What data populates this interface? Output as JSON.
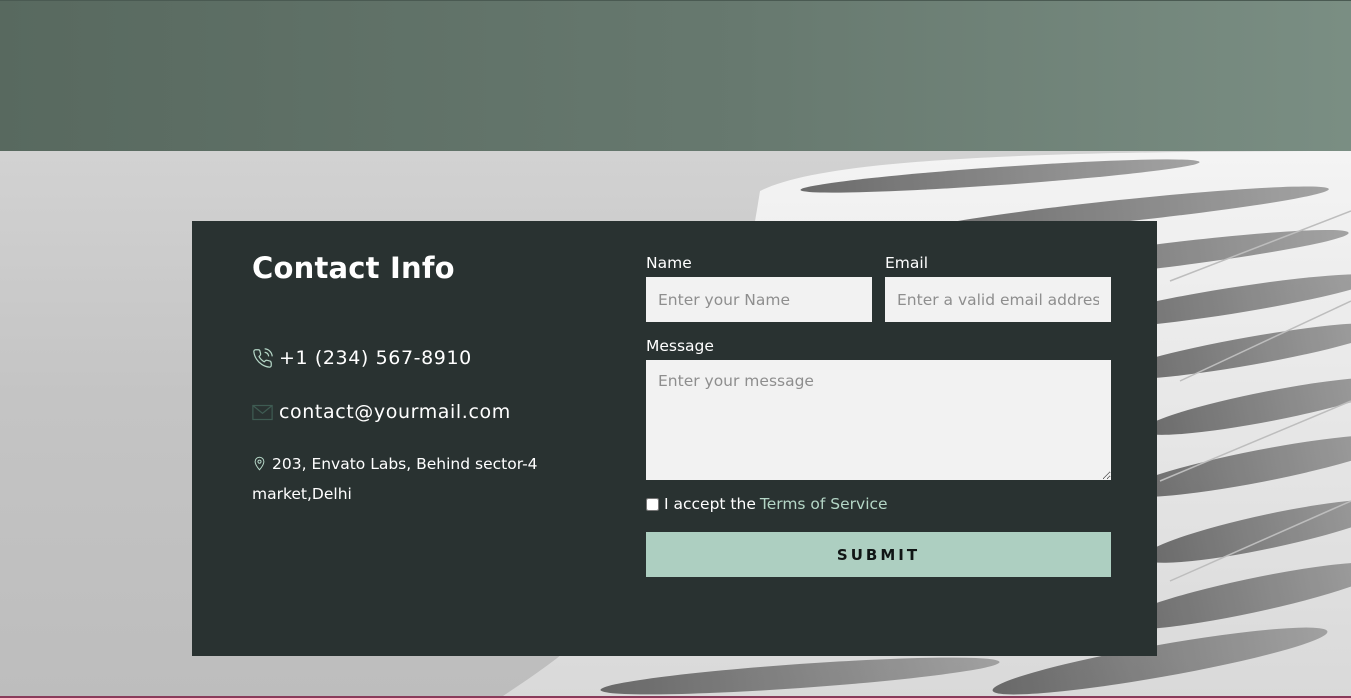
{
  "contact_info": {
    "title": "Contact Info",
    "phone": "+1 (234) 567-8910",
    "email": "contact@yourmail.com",
    "address": "203, Envato Labs, Behind sector-4 market,Delhi"
  },
  "form": {
    "name_label": "Name",
    "name_placeholder": "Enter your Name",
    "email_label": "Email",
    "email_placeholder": "Enter a valid email address",
    "message_label": "Message",
    "message_placeholder": "Enter your message",
    "terms_prefix": "I accept the",
    "terms_link": "Terms of Service",
    "submit_label": "SUBMIT",
    "terms_checked": false
  },
  "icons": {
    "phone": "phone-icon",
    "email": "envelope-icon",
    "address": "map-pin-icon"
  },
  "colors": {
    "card_background": "#293231",
    "accent": "#adcfc1",
    "link": "#b4d6c6",
    "header_band": "#67796f"
  }
}
